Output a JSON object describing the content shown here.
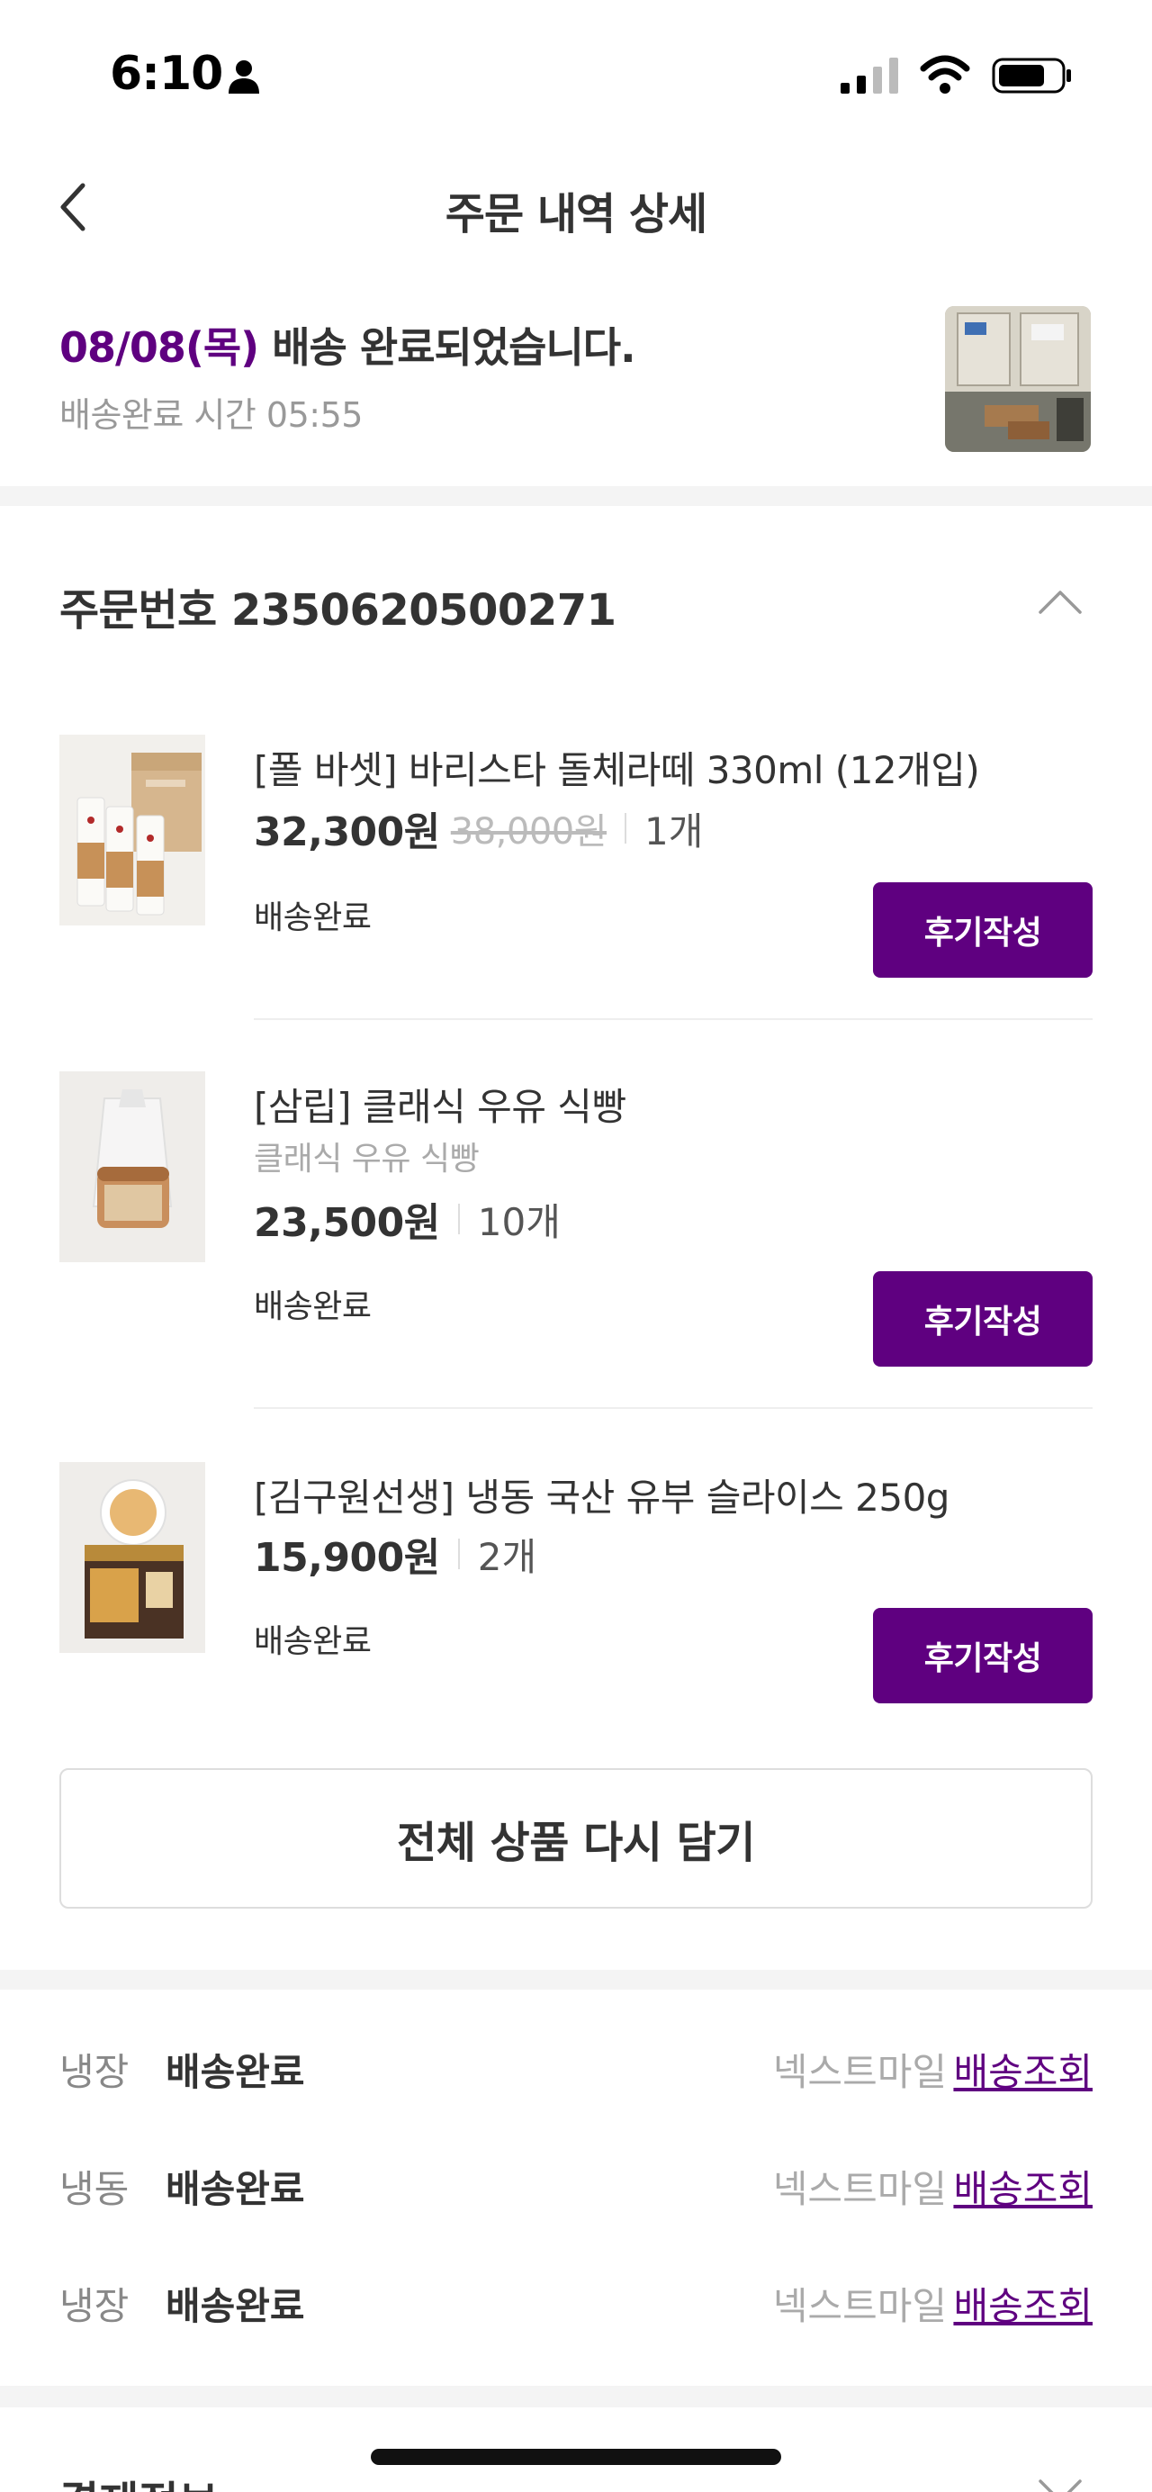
{
  "status_bar": {
    "time": "6:10"
  },
  "header": {
    "title": "주문 내역 상세"
  },
  "delivery": {
    "date": "08/08(목)",
    "message": "배송 완료되었습니다.",
    "time_text": "배송완료 시간 05:55"
  },
  "order": {
    "number_label": "주문번호 2350620500271",
    "items": [
      {
        "name": "[폴 바셋] 바리스타 돌체라떼 330ml (12개입)",
        "price": "32,300원",
        "original_price": "38,000원",
        "quantity": "1개",
        "status": "배송완료",
        "review_label": "후기작성"
      },
      {
        "name": "[삼립] 클래식 우유 식빵",
        "option": "클래식 우유 식빵",
        "price": "23,500원",
        "quantity": "10개",
        "status": "배송완료",
        "review_label": "후기작성"
      },
      {
        "name": "[김구원선생] 냉동 국산 유부 슬라이스 250g",
        "price": "15,900원",
        "quantity": "2개",
        "status": "배송완료",
        "review_label": "후기작성"
      }
    ],
    "reorder_label": "전체 상품 다시 담기"
  },
  "shipments": [
    {
      "type": "냉장",
      "status": "배송완료",
      "carrier": "넥스트마일",
      "track_label": "배송조회"
    },
    {
      "type": "냉동",
      "status": "배송완료",
      "carrier": "넥스트마일",
      "track_label": "배송조회"
    },
    {
      "type": "냉장",
      "status": "배송완료",
      "carrier": "넥스트마일",
      "track_label": "배송조회"
    }
  ],
  "payment": {
    "title": "결제정보"
  },
  "colors": {
    "accent": "#5f0080",
    "divider": "#f4f4f4"
  },
  "icons": [
    "person-icon",
    "signal-icon",
    "wifi-icon",
    "battery-icon",
    "back-arrow-icon",
    "chevron-up-icon",
    "chevron-down-icon"
  ]
}
